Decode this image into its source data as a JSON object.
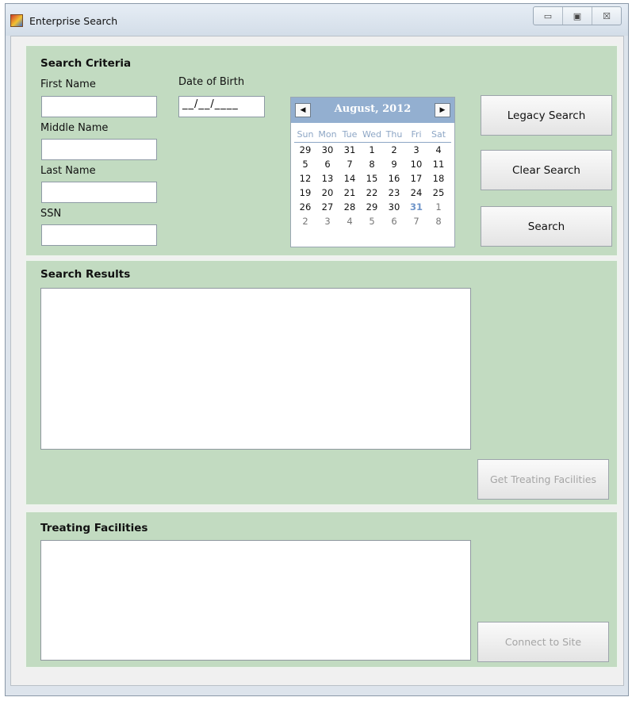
{
  "window": {
    "title": "Enterprise Search",
    "controls": [
      "▭",
      "▣",
      "☒"
    ]
  },
  "criteria": {
    "title": "Search Criteria",
    "first_name_label": "First Name",
    "first_name_value": "",
    "middle_name_label": "Middle Name",
    "middle_name_value": "",
    "last_name_label": "Last Name",
    "last_name_value": "",
    "ssn_label": "SSN",
    "ssn_value": "",
    "dob_label": "Date of Birth",
    "dob_value": "__/__/____"
  },
  "calendar": {
    "month_label": "August, 2012",
    "prev_glyph": "◀",
    "next_glyph": "▶",
    "days_of_week": [
      "Sun",
      "Mon",
      "Tue",
      "Wed",
      "Thu",
      "Fri",
      "Sat"
    ],
    "weeks": [
      [
        "29",
        "30",
        "31",
        "1",
        "2",
        "3",
        "4"
      ],
      [
        "5",
        "6",
        "7",
        "8",
        "9",
        "10",
        "11"
      ],
      [
        "12",
        "13",
        "14",
        "15",
        "16",
        "17",
        "18"
      ],
      [
        "19",
        "20",
        "21",
        "22",
        "23",
        "24",
        "25"
      ],
      [
        "26",
        "27",
        "28",
        "29",
        "30",
        "31",
        "1"
      ],
      [
        "2",
        "3",
        "4",
        "5",
        "6",
        "7",
        "8"
      ]
    ]
  },
  "buttons": {
    "legacy_search": "Legacy Search",
    "clear_search": "Clear Search",
    "search": "Search",
    "get_treating_facilities": "Get Treating Facilities",
    "connect_to_site": "Connect to Site"
  },
  "results": {
    "title": "Search Results"
  },
  "facilities": {
    "title": "Treating Facilities"
  }
}
